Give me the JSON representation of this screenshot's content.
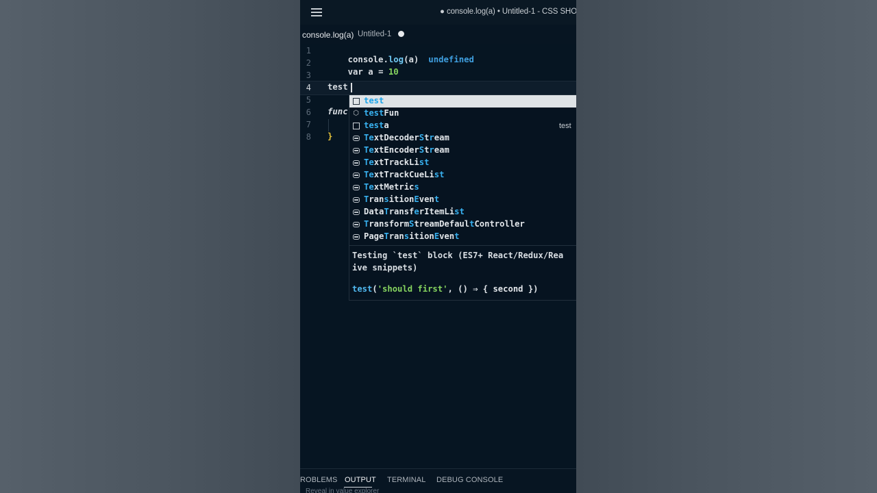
{
  "window": {
    "title": "● console.log(a) • Untitled-1 - CSS SHO"
  },
  "tab": {
    "label": "console.log(a)",
    "description": "Untitled-1"
  },
  "editor": {
    "line_numbers": [
      "1",
      "2",
      "3",
      "4",
      "5",
      "6",
      "7",
      "8"
    ],
    "line1": {
      "obj": "console",
      "dot": ".",
      "method": "log",
      "args": "(a)",
      "inline_value": "undefined"
    },
    "line2": {
      "kw": "var",
      "name": "a",
      "eq": "=",
      "num": "10"
    },
    "line4": {
      "text": "test"
    },
    "line6": {
      "text": "func"
    },
    "line8": {
      "text": "}"
    }
  },
  "suggestions": {
    "items": [
      {
        "label": "test",
        "icon": "snippet-icon"
      },
      {
        "label": "testFun",
        "icon": "cube-icon"
      },
      {
        "label": "testa",
        "icon": "snippet-icon",
        "detail": "test"
      },
      {
        "label": "TextDecoderStream",
        "icon": "variable-icon"
      },
      {
        "label": "TextEncoderStream",
        "icon": "variable-icon"
      },
      {
        "label": "TextTrackList",
        "icon": "variable-icon"
      },
      {
        "label": "TextTrackCueList",
        "icon": "variable-icon"
      },
      {
        "label": "TextMetrics",
        "icon": "variable-icon"
      },
      {
        "label": "TransitionEvent",
        "icon": "variable-icon"
      },
      {
        "label": "DataTransferItemList",
        "icon": "variable-icon"
      },
      {
        "label": "TransformStreamDefaultController",
        "icon": "variable-icon"
      },
      {
        "label": "PageTransitionEvent",
        "icon": "variable-icon"
      }
    ],
    "selected_index": 0
  },
  "details": {
    "description": "Testing `test` block (ES7+ React/Redux/Rea\nive snippets)",
    "code_fn": "test",
    "code_open": "(",
    "code_str": "'should first'",
    "code_rest": ", () ⇒ { second })"
  },
  "panel": {
    "tabs": [
      "ROBLEMS",
      "OUTPUT",
      "TERMINAL",
      "DEBUG CONSOLE"
    ],
    "active_tab": "OUTPUT",
    "cut_text": "Reveal in value explorer"
  },
  "colors": {
    "editor_bg": "#061522",
    "selection_bg": "#dfe3e6",
    "match_highlight": "#38b1f0",
    "number": "#86d45f",
    "inline_value": "#3f9fe0"
  }
}
